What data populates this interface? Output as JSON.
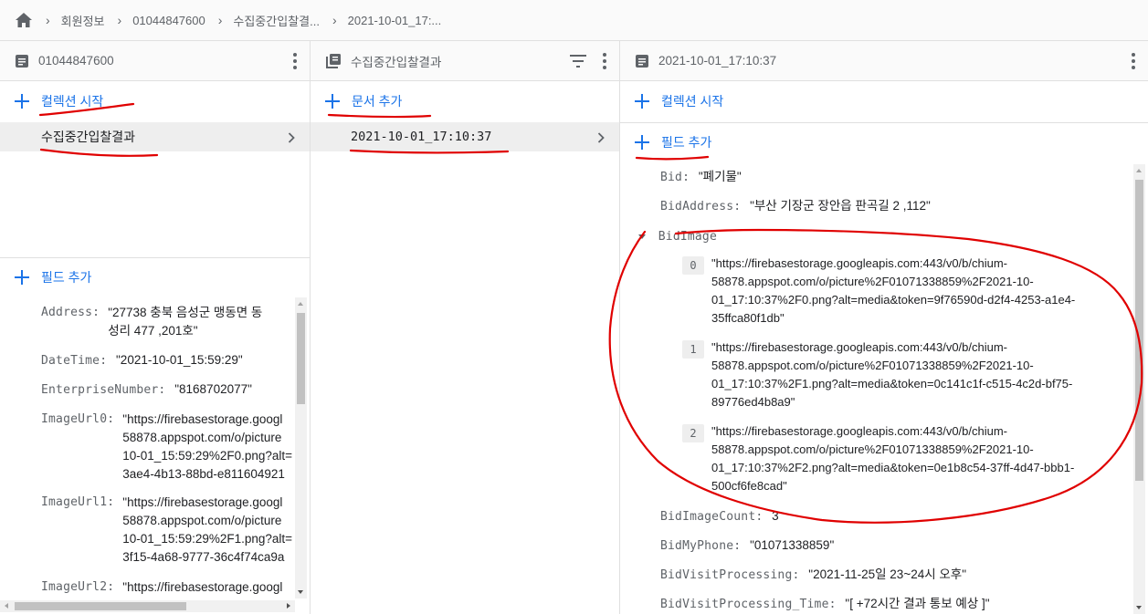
{
  "breadcrumb": {
    "items": [
      "회원정보",
      "01044847600",
      "수집중간입찰결...",
      "2021-10-01_17:..."
    ]
  },
  "col1": {
    "title": "01044847600",
    "add_collection": "컬렉션 시작",
    "collections": [
      "수집중간입찰결과"
    ],
    "add_field": "필드 추가",
    "fields": [
      {
        "key": "Address:",
        "value": [
          "\"27738 충북 음성군 맹동면 동",
          "성리 477 ,201호\""
        ]
      },
      {
        "key": "DateTime:",
        "value": [
          "\"2021-10-01_15:59:29\""
        ]
      },
      {
        "key": "EnterpriseNumber:",
        "value": [
          "\"8168702077\""
        ]
      },
      {
        "key": "ImageUrl0:",
        "value": [
          "\"https://firebasestorage.googl",
          "58878.appspot.com/o/picture",
          "10-01_15:59:29%2F0.png?alt=",
          "3ae4-4b13-88bd-e811604921"
        ]
      },
      {
        "key": "ImageUrl1:",
        "value": [
          "\"https://firebasestorage.googl",
          "58878.appspot.com/o/picture",
          "10-01_15:59:29%2F1.png?alt=",
          "3f15-4a68-9777-36c4f74ca9a"
        ]
      },
      {
        "key": "ImageUrl2:",
        "value": [
          "\"https://firebasestorage.googl"
        ]
      }
    ]
  },
  "col2": {
    "title": "수집중간입찰결과",
    "add_document": "문서 추가",
    "documents": [
      "2021-10-01_17:10:37"
    ]
  },
  "col3": {
    "title": "2021-10-01_17:10:37",
    "add_collection": "컬렉션 시작",
    "add_field": "필드 추가",
    "fields_top": [
      {
        "key": "Bid:",
        "value": "\"폐기물\""
      },
      {
        "key": "BidAddress:",
        "value": "\"부산 기장군 장안읍 판곡길 2 ,112\""
      }
    ],
    "array_key": "BidImage",
    "array_items": [
      {
        "index": "0",
        "lines": [
          "\"https://firebasestorage.googleapis.com:443/v0/b/chium-",
          "58878.appspot.com/o/picture%2F01071338859%2F2021-10-",
          "01_17:10:37%2F0.png?alt=media&token=9f76590d-d2f4-4253-a1e4-",
          "35ffca80f1db\""
        ]
      },
      {
        "index": "1",
        "lines": [
          "\"https://firebasestorage.googleapis.com:443/v0/b/chium-",
          "58878.appspot.com/o/picture%2F01071338859%2F2021-10-",
          "01_17:10:37%2F1.png?alt=media&token=0c141c1f-c515-4c2d-bf75-",
          "89776ed4b8a9\""
        ]
      },
      {
        "index": "2",
        "lines": [
          "\"https://firebasestorage.googleapis.com:443/v0/b/chium-",
          "58878.appspot.com/o/picture%2F01071338859%2F2021-10-",
          "01_17:10:37%2F2.png?alt=media&token=0e1b8c54-37ff-4d47-bbb1-",
          "500cf6fe8cad\""
        ]
      }
    ],
    "fields_bottom": [
      {
        "key": "BidImageCount:",
        "value": "3"
      },
      {
        "key": "BidMyPhone:",
        "value": "\"01071338859\""
      },
      {
        "key": "BidVisitProcessing:",
        "value": "\"2021-11-25일 23~24시 오후\""
      },
      {
        "key": "BidVisitProcessing_Time:",
        "value": "\"[ +72시간 결과 통보 예상 ]\""
      }
    ]
  },
  "colors": {
    "accent": "#1a73e8",
    "annotation": "#e00000"
  }
}
